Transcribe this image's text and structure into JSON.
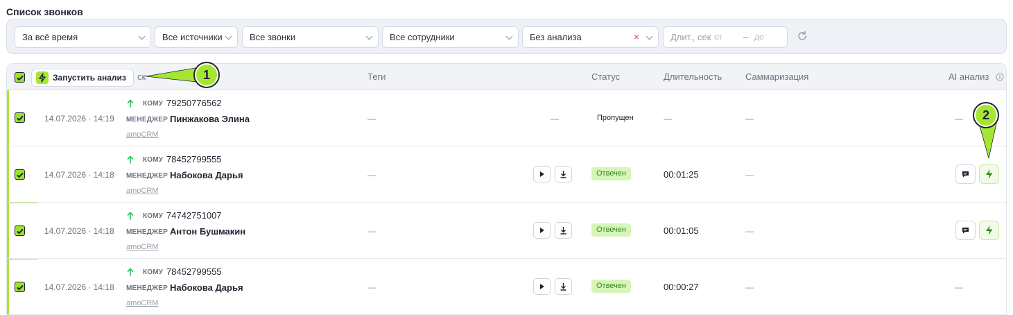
{
  "page": {
    "title": "Список звонков"
  },
  "filters": {
    "period": "За всё время",
    "sources": "Все источники",
    "calls": "Все звонки",
    "employees": "Все сотрудники",
    "analysis": "Без анализа",
    "duration_placeholder": "Длит., сек",
    "from_placeholder": "от",
    "to_placeholder": "до"
  },
  "table": {
    "headers": {
      "teg": "Теги",
      "status": "Статус",
      "duration": "Длительность",
      "summary": "Саммаризация",
      "ai": "AI анализ",
      "partial": "ск"
    },
    "run_analysis_label": "Запустить анализ",
    "to_label": "КОМУ",
    "manager_label": "МЕНЕДЖЕР",
    "dash": "—",
    "rows": [
      {
        "date": "14.07.2026 · 14:19",
        "phone": "79250776562",
        "manager": "Пинжакова Элина",
        "source": "amoCRM",
        "tags": "—",
        "player": "—",
        "status": "Пропущен",
        "duration": "—",
        "summary": "—",
        "ai": "—"
      },
      {
        "date": "14.07.2026 · 14:18",
        "phone": "78452799555",
        "manager": "Набокова Дарья",
        "source": "amoCRM",
        "tags": "—",
        "status": "Отвечен",
        "duration": "00:01:25",
        "summary": "—"
      },
      {
        "date": "14.07.2026 · 14:18",
        "phone": "74742751007",
        "manager": "Антон Бушмакин",
        "source": "amoCRM",
        "tags": "—",
        "status": "Отвечен",
        "duration": "00:01:05",
        "summary": "—"
      },
      {
        "date": "14.07.2026 · 14:18",
        "phone": "78452799555",
        "manager": "Набокова Дарья",
        "source": "amoCRM",
        "tags": "—",
        "status": "Отвечен",
        "duration": "00:00:27",
        "summary": "—",
        "ai": "—"
      }
    ]
  },
  "callouts": {
    "one": "1",
    "two": "2"
  },
  "colors": {
    "accent": "#a5e635",
    "answered_bg": "#d6f5b8",
    "answered_text": "#2f8a1a",
    "arrow": "#22c55e"
  }
}
